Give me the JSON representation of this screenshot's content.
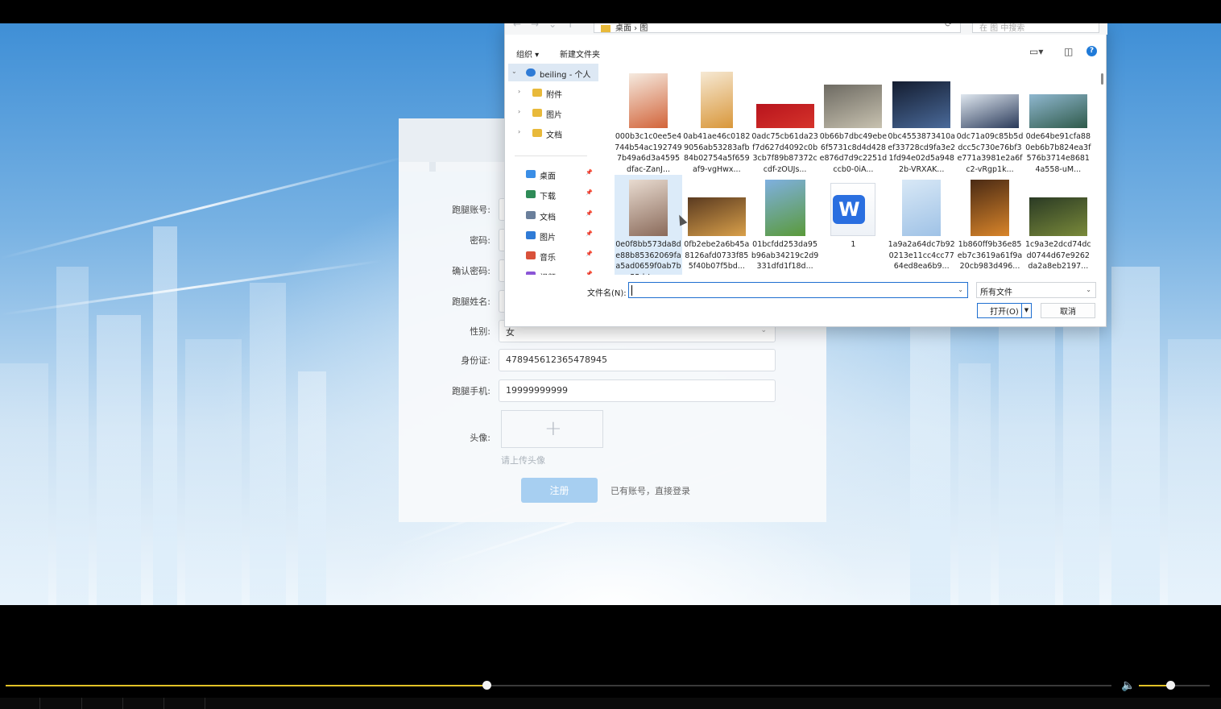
{
  "registration_form": {
    "fields": [
      {
        "label": "跑腿账号:",
        "value": ""
      },
      {
        "label": "密码:",
        "value": ""
      },
      {
        "label": "确认密码:",
        "value": ""
      },
      {
        "label": "跑腿姓名:",
        "value": ""
      },
      {
        "label": "性别:",
        "value": "女"
      },
      {
        "label": "身份证:",
        "value": "478945612365478945"
      },
      {
        "label": "跑腿手机:",
        "value": "19999999999"
      }
    ],
    "avatar_label": "头像:",
    "avatar_hint": "请上传头像",
    "register_button": "注册",
    "login_link": "已有账号，直接登录"
  },
  "file_dialog": {
    "address_path": "桌面 › 图",
    "search_placeholder": "在 图 中搜索",
    "toolbar": {
      "organize": "组织 ▾",
      "new_folder": "新建文件夹"
    },
    "nav_items": [
      {
        "label": "beiling - 个人",
        "icon": "cloud-icon",
        "color": "#2f7bd6",
        "expand": "⌄"
      },
      {
        "label": "附件",
        "icon": "folder-icon",
        "color": "#e8b93a",
        "expand": "›"
      },
      {
        "label": "图片",
        "icon": "folder-icon",
        "color": "#e8b93a",
        "expand": "›"
      },
      {
        "label": "文档",
        "icon": "folder-icon",
        "color": "#e8b93a",
        "expand": "›"
      },
      {
        "label": "桌面",
        "icon": "desktop-icon",
        "color": "#3a8ee6",
        "pinned": true
      },
      {
        "label": "下载",
        "icon": "download-icon",
        "color": "#2e8b57",
        "pinned": true
      },
      {
        "label": "文档",
        "icon": "document-icon",
        "color": "#6a7f9b",
        "pinned": true
      },
      {
        "label": "图片",
        "icon": "picture-icon",
        "color": "#2f7bd6",
        "pinned": true
      },
      {
        "label": "音乐",
        "icon": "music-icon",
        "color": "#d9513a",
        "pinned": true
      },
      {
        "label": "视频",
        "icon": "video-icon",
        "color": "#8b56d6",
        "pinned": true
      }
    ],
    "files": [
      {
        "name": "000b3c1c0ee5e4744b54ac1927497b49a6d3a4595dfac-ZanJ...",
        "colors": [
          "#f5eadf",
          "#d2643a"
        ],
        "w": 48,
        "h": 68
      },
      {
        "name": "0ab41ae46c01829056ab53283afb84b02754a5f659af9-vgHwx...",
        "colors": [
          "#f6e9d4",
          "#d9973a"
        ],
        "w": 40,
        "h": 70
      },
      {
        "name": "0adc75cb61da23f7d627d4092c0b3cb7f89b87372ccdf-zOUJs...",
        "colors": [
          "#b8141d",
          "#d6342b"
        ],
        "w": 72,
        "h": 30
      },
      {
        "name": "0b66b7dbc49ebe6f5731c8d4d428e876d7d9c2251dccb0-0iA...",
        "colors": [
          "#6d6a62",
          "#c8c2b0"
        ],
        "w": 72,
        "h": 54
      },
      {
        "name": "0bc4553873410aef33728cd9fa3e21fd94e02d5a9482b-VRXAK...",
        "colors": [
          "#141d30",
          "#4a6a9a"
        ],
        "w": 72,
        "h": 58
      },
      {
        "name": "0dc71a09c85b5ddcc5c730e76bf3e771a3981e2a6fc2-vRgp1k...",
        "colors": [
          "#dfe7ef",
          "#2a3a5a"
        ],
        "w": 72,
        "h": 42
      },
      {
        "name": "0de64be91cfa880eb6b7b824ea3f576b3714e86814a558-uM...",
        "colors": [
          "#8fb7cf",
          "#2f5a4a"
        ],
        "w": 72,
        "h": 42
      },
      {
        "name": "0e0f8bb573da8de88b85362069faa5ad0659f0ab7b55d-Jqx...",
        "colors": [
          "#e8dbd0",
          "#8a6a5a"
        ],
        "w": 48,
        "h": 70
      },
      {
        "name": "0fb2ebe2a6b45a8126afd0733f855f40b07f5bd...",
        "colors": [
          "#5a3a20",
          "#d9a04a"
        ],
        "w": 72,
        "h": 48
      },
      {
        "name": "01bcfdd253da95b96ab34219c2d9331dfd1f18d...",
        "colors": [
          "#7fb0e0",
          "#5a9a3a"
        ],
        "w": 50,
        "h": 70
      },
      {
        "name": "1",
        "colors": [
          "#2a6fe0",
          "#ffffff"
        ],
        "w": 56,
        "h": 66
      },
      {
        "name": "1a9a2a64dc7b920213e11cc4cc7764ed8ea6b9...",
        "colors": [
          "#d8e8f6",
          "#9fc2e6"
        ],
        "w": 48,
        "h": 70
      },
      {
        "name": "1b860ff9b36e85eb7c3619a61f9a20cb983d496...",
        "colors": [
          "#4a2a14",
          "#d9852a"
        ],
        "w": 48,
        "h": 70
      },
      {
        "name": "1c9a3e2dcd74dcd0744d67e9262da2a8eb2197...",
        "colors": [
          "#2a3a24",
          "#7a8a3a"
        ],
        "w": 72,
        "h": 48
      }
    ],
    "filename_label": "文件名(N):",
    "filename_value": "",
    "filter_value": "所有文件",
    "open_button": "打开(O)",
    "cancel_button": "取消"
  },
  "player": {
    "progress": 0.435,
    "volume": 0.445
  }
}
